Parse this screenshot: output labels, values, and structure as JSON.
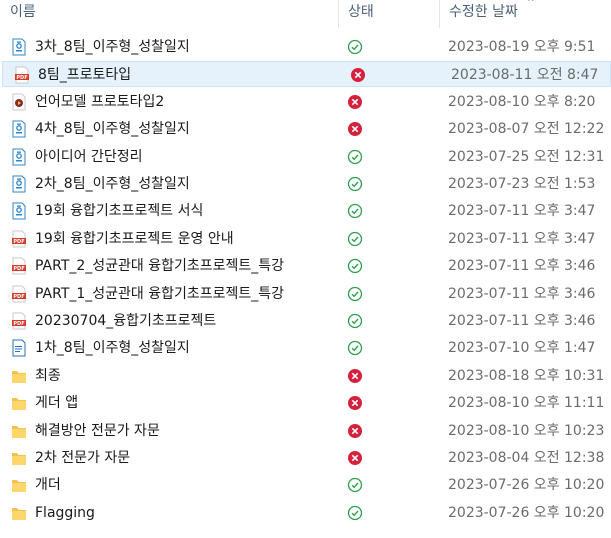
{
  "columns": {
    "name": "이름",
    "status": "상태",
    "date": "수정한 날짜"
  },
  "colors": {
    "ok": "#2e9e4f",
    "error": "#d4213d",
    "folder": "#f5c14c",
    "pdf": "#d73a2a",
    "hwp": "#2f86c6"
  },
  "files": [
    {
      "name": "3차_8팀_이주형_성찰일지",
      "icon": "hwp-icon",
      "status": "ok",
      "date": "2023-08-19 오후 9:51"
    },
    {
      "name": "8팀_프로토타입",
      "icon": "pdf-icon",
      "status": "error",
      "date": "2023-08-11 오전 8:47",
      "selected": true
    },
    {
      "name": "언어모델 프로토타입2",
      "icon": "video-icon",
      "status": "error",
      "date": "2023-08-10 오후 8:20"
    },
    {
      "name": "4차_8팀_이주형_성찰일지",
      "icon": "hwp-icon",
      "status": "error",
      "date": "2023-08-07 오전 12:22"
    },
    {
      "name": "아이디어 간단정리",
      "icon": "hwp-icon",
      "status": "ok",
      "date": "2023-07-25 오전 12:31"
    },
    {
      "name": "2차_8팀_이주형_성찰일지",
      "icon": "hwp-icon",
      "status": "ok",
      "date": "2023-07-23 오전 1:53"
    },
    {
      "name": "19회 융합기초프로젝트 서식",
      "icon": "hwp-icon",
      "status": "ok",
      "date": "2023-07-11 오후 3:47"
    },
    {
      "name": "19회 융합기초프로젝트 운영 안내",
      "icon": "pdf-icon",
      "status": "ok",
      "date": "2023-07-11 오후 3:47"
    },
    {
      "name": "PART_2_성균관대 융합기초프로젝트_특강",
      "icon": "pdf-icon",
      "status": "ok",
      "date": "2023-07-11 오후 3:46"
    },
    {
      "name": "PART_1_성균관대 융합기초프로젝트_특강",
      "icon": "pdf-icon",
      "status": "ok",
      "date": "2023-07-11 오후 3:46"
    },
    {
      "name": "20230704_융합기초프로젝트",
      "icon": "pdf-icon",
      "status": "ok",
      "date": "2023-07-11 오후 3:46"
    },
    {
      "name": "1차_8팀_이주형_성찰일지",
      "icon": "doc-icon",
      "status": "ok",
      "date": "2023-07-10 오후 1:47"
    },
    {
      "name": "최종",
      "icon": "folder-icon",
      "status": "error",
      "date": "2023-08-18 오후 10:31"
    },
    {
      "name": "게더 앱",
      "icon": "folder-icon",
      "status": "error",
      "date": "2023-08-10 오후 11:11"
    },
    {
      "name": "해결방안 전문가 자문",
      "icon": "folder-icon",
      "status": "error",
      "date": "2023-08-10 오후 10:23"
    },
    {
      "name": "2차 전문가 자문",
      "icon": "folder-icon",
      "status": "error",
      "date": "2023-08-04 오전 12:38"
    },
    {
      "name": "개더",
      "icon": "folder-icon",
      "status": "ok",
      "date": "2023-07-26 오후 10:20"
    },
    {
      "name": "Flagging",
      "icon": "folder-icon",
      "status": "ok",
      "date": "2023-07-26 오후 10:20"
    }
  ]
}
